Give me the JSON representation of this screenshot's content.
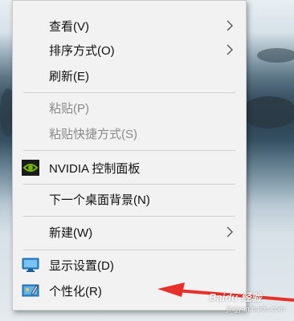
{
  "menu": {
    "items": [
      {
        "label": "查看(V)",
        "submenu": true,
        "disabled": false
      },
      {
        "label": "排序方式(O)",
        "submenu": true,
        "disabled": false
      },
      {
        "label": "刷新(E)",
        "submenu": false,
        "disabled": false
      },
      {
        "label": "粘贴(P)",
        "submenu": false,
        "disabled": true
      },
      {
        "label": "粘贴快捷方式(S)",
        "submenu": false,
        "disabled": true
      },
      {
        "label": "NVIDIA 控制面板",
        "submenu": false,
        "disabled": false,
        "icon": "nvidia-icon"
      },
      {
        "label": "下一个桌面背景(N)",
        "submenu": false,
        "disabled": false
      },
      {
        "label": "新建(W)",
        "submenu": true,
        "disabled": false
      },
      {
        "label": "显示设置(D)",
        "submenu": false,
        "disabled": false,
        "icon": "display-icon"
      },
      {
        "label": "个性化(R)",
        "submenu": false,
        "disabled": false,
        "icon": "personalize-icon"
      }
    ]
  },
  "watermark": {
    "brand": "Baidu 经验",
    "url": "jingyan.baidu.com"
  },
  "colors": {
    "menu_bg": "#f2f2f2",
    "arrow": "#e8302a",
    "disabled_text": "#8a8a8a",
    "nvidia_green": "#76b900"
  }
}
